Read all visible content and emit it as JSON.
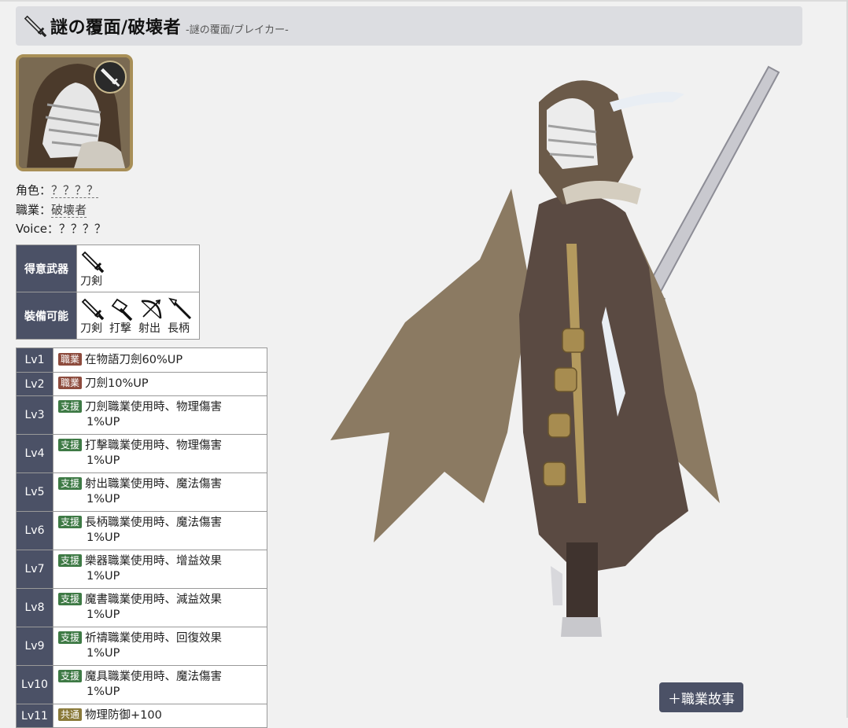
{
  "header": {
    "title": "謎の覆面/破壊者",
    "subtitle": "-謎の覆面/ブレイカー-"
  },
  "info": {
    "role_label": "角色：",
    "role_value": "？？？？",
    "job_label": "職業：",
    "job_value": "破壊者",
    "voice_label": "Voice：",
    "voice_value": "？？？？"
  },
  "weapons": {
    "preferred_header": "得意武器",
    "equippable_header": "裝備可能",
    "preferred": [
      {
        "icon": "sword-icon",
        "label": "刀剣"
      }
    ],
    "equippable": [
      {
        "icon": "sword-icon",
        "label": "刀剣"
      },
      {
        "icon": "hammer-icon",
        "label": "打撃"
      },
      {
        "icon": "bow-icon",
        "label": "射出"
      },
      {
        "icon": "spear-icon",
        "label": "長柄"
      }
    ]
  },
  "skills": [
    {
      "lv": "Lv1",
      "tag": "職業",
      "line1": "在物語刀劍60%UP",
      "line2": ""
    },
    {
      "lv": "Lv2",
      "tag": "職業",
      "line1": "刀劍10%UP",
      "line2": ""
    },
    {
      "lv": "Lv3",
      "tag": "支援",
      "line1": "刀劍職業使用時、物理傷害",
      "line2": "1%UP"
    },
    {
      "lv": "Lv4",
      "tag": "支援",
      "line1": "打擊職業使用時、物理傷害",
      "line2": "1%UP"
    },
    {
      "lv": "Lv5",
      "tag": "支援",
      "line1": "射出職業使用時、魔法傷害",
      "line2": "1%UP"
    },
    {
      "lv": "Lv6",
      "tag": "支援",
      "line1": "長柄職業使用時、魔法傷害",
      "line2": "1%UP"
    },
    {
      "lv": "Lv7",
      "tag": "支援",
      "line1": "樂器職業使用時、增益效果",
      "line2": "1%UP"
    },
    {
      "lv": "Lv8",
      "tag": "支援",
      "line1": "魔書職業使用時、減益效果",
      "line2": "1%UP"
    },
    {
      "lv": "Lv9",
      "tag": "支援",
      "line1": "祈禱職業使用時、回復效果",
      "line2": "1%UP"
    },
    {
      "lv": "Lv10",
      "tag": "支援",
      "line1": "魔具職業使用時、魔法傷害",
      "line2": "1%UP"
    },
    {
      "lv": "Lv11",
      "tag": "共通",
      "line1": "物理防御+100",
      "line2": ""
    }
  ],
  "story_button": "＋職業故事",
  "colors": {
    "header_bg": "#dcdde1",
    "table_header_bg": "#4b5166",
    "tag_job": "#8d4b3d",
    "tag_support": "#3e7a45"
  }
}
